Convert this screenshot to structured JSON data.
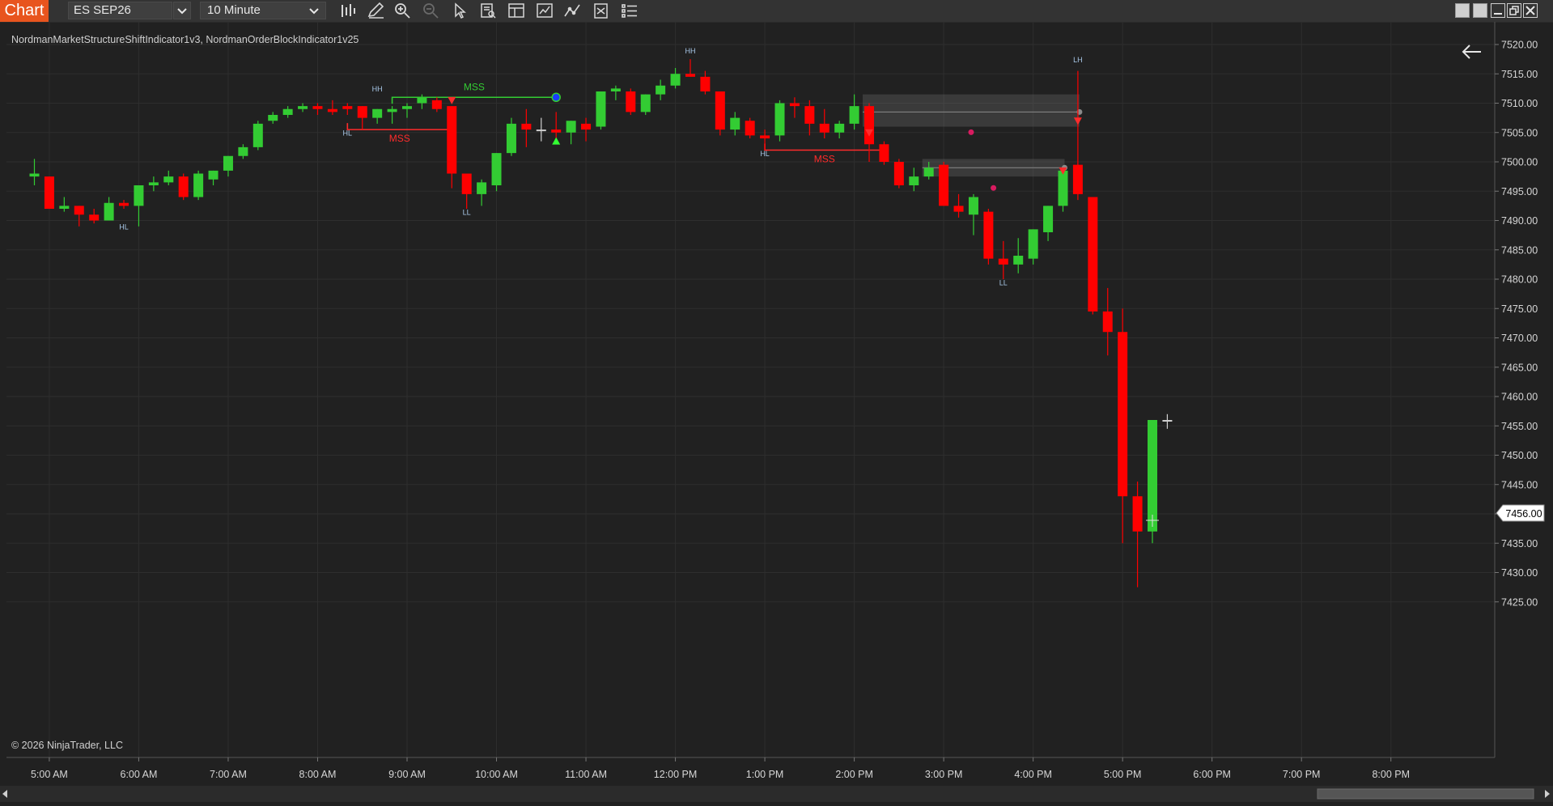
{
  "toolbar": {
    "chart_tab": "Chart",
    "instrument": "ES SEP26",
    "interval": "10 Minute",
    "tools": [
      "bar-type-icon",
      "pencil-icon",
      "zoom-in-icon",
      "zoom-out-icon",
      "pointer-icon",
      "data-box-icon",
      "properties-icon",
      "strategies-icon",
      "indicators-icon",
      "templates-icon",
      "menu-icon"
    ]
  },
  "window_controls": [
    "restore-icon",
    "tile-icon",
    "minimize-icon",
    "maximize-icon",
    "close-icon"
  ],
  "chart": {
    "indicators_label": "NordmanMarketStructureShiftIndicator1v3, NordmanOrderBlockIndicator1v25",
    "copyright": "© 2026 NinjaTrader, LLC",
    "current_price_label": "7456.00",
    "y_ticks": [
      "7520.00",
      "7515.00",
      "7510.00",
      "7505.00",
      "7500.00",
      "7495.00",
      "7490.00",
      "7485.00",
      "7480.00",
      "7475.00",
      "7470.00",
      "7465.00",
      "7460.00",
      "7455.00",
      "7450.00",
      "7445.00",
      "7440.00",
      "7435.00",
      "7430.00",
      "7425.00"
    ],
    "x_ticks": [
      "5:00 AM",
      "6:00 AM",
      "7:00 AM",
      "8:00 AM",
      "9:00 AM",
      "10:00 AM",
      "11:00 AM",
      "12:00 PM",
      "1:00 PM",
      "2:00 PM",
      "3:00 PM",
      "4:00 PM",
      "5:00 PM",
      "6:00 PM",
      "7:00 PM",
      "8:00 PM"
    ]
  },
  "chart_data": {
    "type": "candlestick",
    "instrument": "ES SEP26",
    "interval": "10 Minute",
    "ylim": [
      7423,
      7522
    ],
    "up_color": "#33cc33",
    "down_color": "#ff0000",
    "candles": [
      {
        "t": "4:50 AM",
        "o": 7497.5,
        "h": 7500.5,
        "l": 7496.0,
        "c": 7498.0
      },
      {
        "t": "5:00 AM",
        "o": 7497.5,
        "h": 7497.5,
        "l": 7492.0,
        "c": 7492.0
      },
      {
        "t": "5:10 AM",
        "o": 7492.0,
        "h": 7494.0,
        "l": 7491.5,
        "c": 7492.5
      },
      {
        "t": "5:20 AM",
        "o": 7492.5,
        "h": 7492.5,
        "l": 7489.0,
        "c": 7491.0
      },
      {
        "t": "5:30 AM",
        "o": 7491.0,
        "h": 7492.0,
        "l": 7489.5,
        "c": 7490.0
      },
      {
        "t": "5:40 AM",
        "o": 7490.0,
        "h": 7494.0,
        "l": 7490.0,
        "c": 7493.0
      },
      {
        "t": "5:50 AM",
        "o": 7493.0,
        "h": 7493.5,
        "l": 7492.0,
        "c": 7492.5
      },
      {
        "t": "6:00 AM",
        "o": 7492.5,
        "h": 7496.0,
        "l": 7489.0,
        "c": 7496.0
      },
      {
        "t": "6:10 AM",
        "o": 7496.0,
        "h": 7497.5,
        "l": 7495.0,
        "c": 7496.5
      },
      {
        "t": "6:20 AM",
        "o": 7496.5,
        "h": 7498.5,
        "l": 7496.0,
        "c": 7497.5
      },
      {
        "t": "6:30 AM",
        "o": 7497.5,
        "h": 7498.0,
        "l": 7493.5,
        "c": 7494.0
      },
      {
        "t": "6:40 AM",
        "o": 7494.0,
        "h": 7498.5,
        "l": 7493.5,
        "c": 7498.0
      },
      {
        "t": "6:50 AM",
        "o": 7497.0,
        "h": 7498.5,
        "l": 7496.0,
        "c": 7498.5
      },
      {
        "t": "7:00 AM",
        "o": 7498.5,
        "h": 7501.0,
        "l": 7497.5,
        "c": 7501.0
      },
      {
        "t": "7:10 AM",
        "o": 7501.0,
        "h": 7503.0,
        "l": 7500.5,
        "c": 7502.5
      },
      {
        "t": "7:20 AM",
        "o": 7502.5,
        "h": 7507.0,
        "l": 7502.0,
        "c": 7506.5
      },
      {
        "t": "7:30 AM",
        "o": 7507.0,
        "h": 7508.5,
        "l": 7506.5,
        "c": 7508.0
      },
      {
        "t": "7:40 AM",
        "o": 7508.0,
        "h": 7509.5,
        "l": 7507.5,
        "c": 7509.0
      },
      {
        "t": "7:50 AM",
        "o": 7509.0,
        "h": 7510.0,
        "l": 7508.5,
        "c": 7509.5
      },
      {
        "t": "8:00 AM",
        "o": 7509.5,
        "h": 7510.0,
        "l": 7508.0,
        "c": 7509.0
      },
      {
        "t": "8:10 AM",
        "o": 7509.0,
        "h": 7510.5,
        "l": 7508.0,
        "c": 7508.5
      },
      {
        "t": "8:20 AM",
        "o": 7509.5,
        "h": 7510.0,
        "l": 7508.0,
        "c": 7509.0
      },
      {
        "t": "8:30 AM",
        "o": 7509.5,
        "h": 7509.5,
        "l": 7505.5,
        "c": 7507.5
      },
      {
        "t": "8:40 AM",
        "o": 7507.5,
        "h": 7509.0,
        "l": 7506.5,
        "c": 7509.0
      },
      {
        "t": "8:50 AM",
        "o": 7508.5,
        "h": 7509.5,
        "l": 7506.5,
        "c": 7509.0
      },
      {
        "t": "9:00 AM",
        "o": 7509.0,
        "h": 7510.0,
        "l": 7507.5,
        "c": 7509.5
      },
      {
        "t": "9:10 AM",
        "o": 7510.0,
        "h": 7511.5,
        "l": 7509.0,
        "c": 7511.0
      },
      {
        "t": "9:20 AM",
        "o": 7510.5,
        "h": 7511.0,
        "l": 7508.5,
        "c": 7509.0
      },
      {
        "t": "9:30 AM",
        "o": 7509.5,
        "h": 7509.5,
        "l": 7495.5,
        "c": 7498.0
      },
      {
        "t": "9:40 AM",
        "o": 7498.0,
        "h": 7498.0,
        "l": 7492.0,
        "c": 7494.5
      },
      {
        "t": "9:50 AM",
        "o": 7494.5,
        "h": 7497.0,
        "l": 7492.5,
        "c": 7496.5
      },
      {
        "t": "10:00 AM",
        "o": 7496.0,
        "h": 7501.5,
        "l": 7495.0,
        "c": 7501.5
      },
      {
        "t": "10:10 AM",
        "o": 7501.5,
        "h": 7507.5,
        "l": 7501.0,
        "c": 7506.5
      },
      {
        "t": "10:20 AM",
        "o": 7506.5,
        "h": 7509.0,
        "l": 7502.5,
        "c": 7505.5
      },
      {
        "t": "10:30 AM",
        "o": 7505.5,
        "h": 7507.5,
        "l": 7503.5,
        "c": 7505.5
      },
      {
        "t": "10:40 AM",
        "o": 7505.5,
        "h": 7508.5,
        "l": 7503.0,
        "c": 7505.0
      },
      {
        "t": "10:50 AM",
        "o": 7505.0,
        "h": 7507.0,
        "l": 7503.0,
        "c": 7507.0
      },
      {
        "t": "11:00 AM",
        "o": 7506.5,
        "h": 7507.5,
        "l": 7503.5,
        "c": 7505.5
      },
      {
        "t": "11:10 AM",
        "o": 7506.0,
        "h": 7512.0,
        "l": 7505.5,
        "c": 7512.0
      },
      {
        "t": "11:20 AM",
        "o": 7512.0,
        "h": 7513.0,
        "l": 7510.5,
        "c": 7512.5
      },
      {
        "t": "11:30 AM",
        "o": 7512.0,
        "h": 7512.5,
        "l": 7508.0,
        "c": 7508.5
      },
      {
        "t": "11:40 AM",
        "o": 7508.5,
        "h": 7511.5,
        "l": 7508.0,
        "c": 7511.5
      },
      {
        "t": "11:50 AM",
        "o": 7511.5,
        "h": 7514.0,
        "l": 7510.5,
        "c": 7513.0
      },
      {
        "t": "12:00 PM",
        "o": 7513.0,
        "h": 7516.0,
        "l": 7512.5,
        "c": 7515.0
      },
      {
        "t": "12:10 PM",
        "o": 7515.0,
        "h": 7517.5,
        "l": 7514.5,
        "c": 7514.5
      },
      {
        "t": "12:20 PM",
        "o": 7514.5,
        "h": 7515.5,
        "l": 7511.5,
        "c": 7512.0
      },
      {
        "t": "12:30 PM",
        "o": 7512.0,
        "h": 7512.0,
        "l": 7504.5,
        "c": 7505.5
      },
      {
        "t": "12:40 PM",
        "o": 7505.5,
        "h": 7508.5,
        "l": 7504.5,
        "c": 7507.5
      },
      {
        "t": "12:50 PM",
        "o": 7507.0,
        "h": 7507.5,
        "l": 7504.0,
        "c": 7504.5
      },
      {
        "t": "1:00 PM",
        "o": 7504.5,
        "h": 7505.5,
        "l": 7502.0,
        "c": 7504.0
      },
      {
        "t": "1:10 PM",
        "o": 7504.5,
        "h": 7510.5,
        "l": 7503.5,
        "c": 7510.0
      },
      {
        "t": "1:20 PM",
        "o": 7510.0,
        "h": 7511.0,
        "l": 7507.5,
        "c": 7509.5
      },
      {
        "t": "1:30 PM",
        "o": 7509.5,
        "h": 7510.5,
        "l": 7504.5,
        "c": 7506.5
      },
      {
        "t": "1:40 PM",
        "o": 7506.5,
        "h": 7509.0,
        "l": 7504.0,
        "c": 7505.0
      },
      {
        "t": "1:50 PM",
        "o": 7505.0,
        "h": 7507.0,
        "l": 7504.0,
        "c": 7506.5
      },
      {
        "t": "2:00 PM",
        "o": 7506.5,
        "h": 7511.5,
        "l": 7505.5,
        "c": 7509.5
      },
      {
        "t": "2:10 PM",
        "o": 7509.5,
        "h": 7510.0,
        "l": 7500.0,
        "c": 7503.0
      },
      {
        "t": "2:20 PM",
        "o": 7503.0,
        "h": 7503.5,
        "l": 7499.5,
        "c": 7500.0
      },
      {
        "t": "2:30 PM",
        "o": 7500.0,
        "h": 7500.5,
        "l": 7495.5,
        "c": 7496.0
      },
      {
        "t": "2:40 PM",
        "o": 7496.0,
        "h": 7499.0,
        "l": 7495.0,
        "c": 7497.5
      },
      {
        "t": "2:50 PM",
        "o": 7497.5,
        "h": 7500.0,
        "l": 7497.0,
        "c": 7499.0
      },
      {
        "t": "3:00 PM",
        "o": 7499.5,
        "h": 7500.0,
        "l": 7492.5,
        "c": 7492.5
      },
      {
        "t": "3:10 PM",
        "o": 7492.5,
        "h": 7494.5,
        "l": 7490.5,
        "c": 7491.5
      },
      {
        "t": "3:20 PM",
        "o": 7491.0,
        "h": 7494.5,
        "l": 7487.5,
        "c": 7494.0
      },
      {
        "t": "3:30 PM",
        "o": 7491.5,
        "h": 7492.0,
        "l": 7482.5,
        "c": 7483.5
      },
      {
        "t": "3:40 PM",
        "o": 7483.5,
        "h": 7486.5,
        "l": 7480.0,
        "c": 7482.5
      },
      {
        "t": "3:50 PM",
        "o": 7482.5,
        "h": 7487.0,
        "l": 7481.0,
        "c": 7484.0
      },
      {
        "t": "4:00 PM",
        "o": 7483.5,
        "h": 7488.5,
        "l": 7482.5,
        "c": 7488.5
      },
      {
        "t": "4:10 PM",
        "o": 7488.0,
        "h": 7492.5,
        "l": 7486.5,
        "c": 7492.5
      },
      {
        "t": "4:20 PM",
        "o": 7492.5,
        "h": 7499.0,
        "l": 7491.5,
        "c": 7498.5
      },
      {
        "t": "4:30 PM",
        "o": 7499.5,
        "h": 7515.5,
        "l": 7493.5,
        "c": 7494.5
      },
      {
        "t": "4:40 PM",
        "o": 7494.0,
        "h": 7494.0,
        "l": 7474.0,
        "c": 7474.5
      },
      {
        "t": "4:50 PM",
        "o": 7474.5,
        "h": 7478.5,
        "l": 7467.0,
        "c": 7471.0
      },
      {
        "t": "5:00 PM",
        "o": 7471.0,
        "h": 7475.0,
        "l": 7435.0,
        "c": 7443.0
      },
      {
        "t": "5:10 PM",
        "o": 7443.0,
        "h": 7445.5,
        "l": 7427.5,
        "c": 7437.0
      },
      {
        "t": "5:20 PM",
        "o": 7437.0,
        "h": 7456.0,
        "l": 7435.0,
        "c": 7456.0
      },
      {
        "t": "5:30 PM",
        "o": 7456.0,
        "h": 7457.0,
        "l": 7454.5,
        "c": 7456.0
      }
    ],
    "structure_labels": [
      {
        "text": "HL",
        "t": "5:50 AM",
        "price": 7488.5
      },
      {
        "text": "HL",
        "t": "8:20 AM",
        "price": 7504.5
      },
      {
        "text": "HH",
        "t": "8:40 AM",
        "price": 7512.0
      },
      {
        "text": "LL",
        "t": "9:40 AM",
        "price": 7491.0
      },
      {
        "text": "HH",
        "t": "12:10 PM",
        "price": 7518.5
      },
      {
        "text": "HL",
        "t": "1:00 PM",
        "price": 7501.0
      },
      {
        "text": "LL",
        "t": "3:40 PM",
        "price": 7479.0
      },
      {
        "text": "LH",
        "t": "4:30 PM",
        "price": 7517.0
      }
    ],
    "mss_lines": [
      {
        "text": "MSS",
        "color": "#ff2b2b",
        "from": "8:20 AM",
        "to": "9:30 AM",
        "price": 7505.5
      },
      {
        "text": "MSS",
        "color": "#33cc33",
        "from": "8:50 AM",
        "to": "10:40 AM",
        "price": 7511.0
      },
      {
        "text": "MSS",
        "color": "#ff2b2b",
        "from": "1:00 PM",
        "to": "2:20 PM",
        "price": 7502.0
      }
    ],
    "order_blocks": [
      {
        "from": "2:10 PM",
        "to": "4:30 PM",
        "top": 7511.5,
        "bottom": 7506.0,
        "mid": 7508.5
      },
      {
        "from": "2:50 PM",
        "to": "4:20 PM",
        "top": 7500.5,
        "bottom": 7497.5,
        "mid": 7499.0
      }
    ]
  }
}
